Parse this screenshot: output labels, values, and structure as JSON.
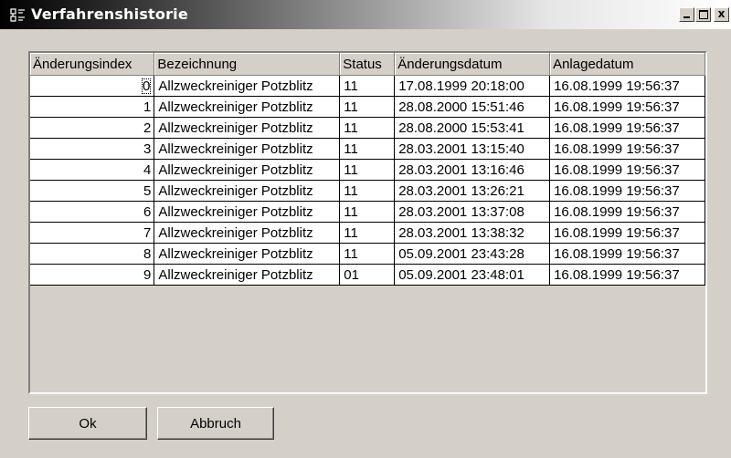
{
  "window": {
    "title": "Verfahrenshistorie",
    "icon": "app-icon",
    "controls": {
      "minimize": "minimize-icon",
      "maximize": "maximize-icon",
      "close_label": "x"
    }
  },
  "table": {
    "columns": [
      "Änderungsindex",
      "Bezeichnung",
      "Status",
      "Änderungsdatum",
      "Anlagedatum"
    ],
    "rows": [
      [
        "0",
        "Allzweckreiniger Potzblitz",
        "11",
        "17.08.1999 20:18:00",
        "16.08.1999 19:56:37"
      ],
      [
        "1",
        "Allzweckreiniger Potzblitz",
        "11",
        "28.08.2000 15:51:46",
        "16.08.1999 19:56:37"
      ],
      [
        "2",
        "Allzweckreiniger Potzblitz",
        "11",
        "28.08.2000 15:53:41",
        "16.08.1999 19:56:37"
      ],
      [
        "3",
        "Allzweckreiniger Potzblitz",
        "11",
        "28.03.2001 13:15:40",
        "16.08.1999 19:56:37"
      ],
      [
        "4",
        "Allzweckreiniger Potzblitz",
        "11",
        "28.03.2001 13:16:46",
        "16.08.1999 19:56:37"
      ],
      [
        "5",
        "Allzweckreiniger Potzblitz",
        "11",
        "28.03.2001 13:26:21",
        "16.08.1999 19:56:37"
      ],
      [
        "6",
        "Allzweckreiniger Potzblitz",
        "11",
        "28.03.2001 13:37:08",
        "16.08.1999 19:56:37"
      ],
      [
        "7",
        "Allzweckreiniger Potzblitz",
        "11",
        "28.03.2001 13:38:32",
        "16.08.1999 19:56:37"
      ],
      [
        "8",
        "Allzweckreiniger Potzblitz",
        "11",
        "05.09.2001 23:43:28",
        "16.08.1999 19:56:37"
      ],
      [
        "9",
        "Allzweckreiniger Potzblitz",
        "01",
        "05.09.2001 23:48:01",
        "16.08.1999 19:56:37"
      ]
    ]
  },
  "buttons": {
    "ok": "Ok",
    "cancel": "Abbruch"
  },
  "colors": {
    "face": "#d4d0c8",
    "cell": "#ffffff",
    "title_dark": "#000000",
    "title_light": "#ffffff"
  }
}
